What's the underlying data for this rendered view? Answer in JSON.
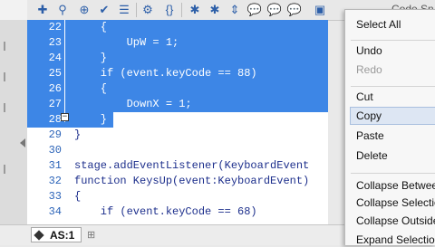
{
  "toolbar": {
    "code_snippets_label": "Code Sn",
    "icons": [
      "add-icon",
      "find-icon",
      "target-icon",
      "check-icon",
      "format-icon",
      "debug-icon",
      "braces-icon",
      "bug-icon",
      "bug-icon",
      "expand-icon",
      "comment-icon",
      "comment-icon",
      "comment-icon",
      "collapse-icon"
    ]
  },
  "editor": {
    "lines": [
      {
        "num": "22",
        "code": "    {",
        "selected": true
      },
      {
        "num": "23",
        "code": "        UpW = 1;",
        "selected": true
      },
      {
        "num": "24",
        "code": "    }",
        "selected": true
      },
      {
        "num": "25",
        "code": "    if (event.keyCode == 88)",
        "selected": true
      },
      {
        "num": "26",
        "code": "    {",
        "selected": true
      },
      {
        "num": "27",
        "code": "        DownX = 1;",
        "selected": true
      },
      {
        "num": "28",
        "code": "    }",
        "selected": true
      },
      {
        "num": "29",
        "code": "}",
        "selected": false
      },
      {
        "num": "30",
        "code": "",
        "selected": false
      },
      {
        "num": "31",
        "code": "stage.addEventListener(KeyboardEvent",
        "selected": false
      },
      {
        "num": "32",
        "code": "function KeysUp(event:KeyboardEvent)",
        "selected": false
      },
      {
        "num": "33",
        "code": "{",
        "selected": false
      },
      {
        "num": "34",
        "code": "    if (event.keyCode == 68)",
        "selected": false
      }
    ]
  },
  "status": {
    "tab_label": "AS:1"
  },
  "context_menu": {
    "items": [
      {
        "label": "Select All",
        "enabled": true
      },
      {
        "label": "Undo",
        "enabled": true
      },
      {
        "label": "Redo",
        "enabled": false
      },
      {
        "label": "Cut",
        "enabled": true
      },
      {
        "label": "Copy",
        "enabled": true
      },
      {
        "label": "Paste",
        "enabled": true
      },
      {
        "label": "Delete",
        "enabled": true
      },
      {
        "label": "Collapse Between",
        "enabled": true
      },
      {
        "label": "Collapse Selection",
        "enabled": true
      },
      {
        "label": "Collapse Outside",
        "enabled": true
      },
      {
        "label": "Expand Selection",
        "enabled": true
      }
    ]
  },
  "colors": {
    "selection": "#3d86e6",
    "line_number": "#2b63b8",
    "code_text": "#1d2f8c"
  }
}
